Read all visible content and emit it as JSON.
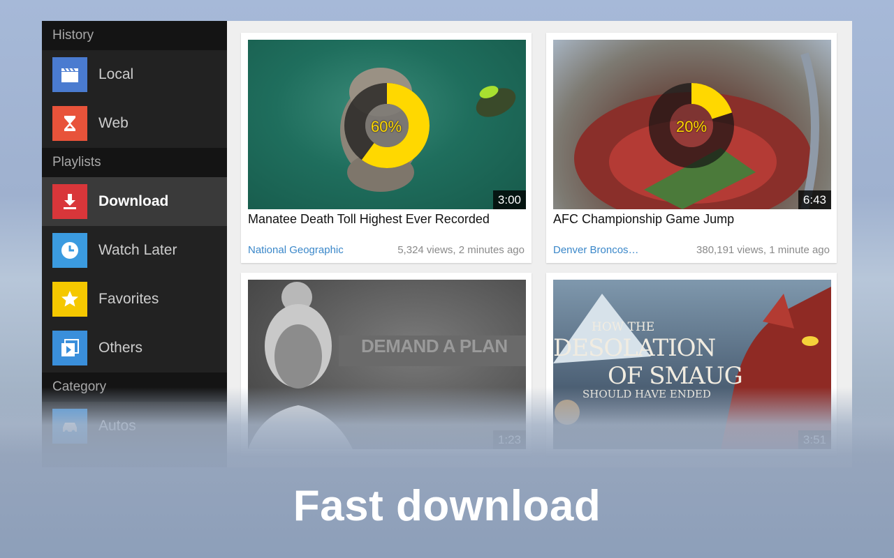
{
  "sidebar": {
    "history_header": "History",
    "history_items": [
      {
        "label": "Local",
        "icon": "clapperboard-icon",
        "color": "#4a7bd0"
      },
      {
        "label": "Web",
        "icon": "hourglass-icon",
        "color": "#e8533a"
      }
    ],
    "playlists_header": "Playlists",
    "playlist_items": [
      {
        "label": "Download",
        "icon": "download-icon",
        "color": "#d9363a",
        "active": true
      },
      {
        "label": "Watch Later",
        "icon": "clock-icon",
        "color": "#3b9be0"
      },
      {
        "label": "Favorites",
        "icon": "star-icon",
        "color": "#f5c800"
      },
      {
        "label": "Others",
        "icon": "video-stack-icon",
        "color": "#3a8fdb"
      }
    ],
    "category_header": "Category",
    "category_items": [
      {
        "label": "Autos",
        "icon": "car-icon",
        "color": "#3a8fdb"
      }
    ]
  },
  "videos": [
    {
      "title": "Manatee Death Toll Highest Ever Recorded",
      "channel": "National Geographic",
      "views": "5,324 views, 2 minutes ago",
      "duration": "3:00",
      "progress_label": "60%",
      "progress": 0.6
    },
    {
      "title": "AFC Championship Game Jump",
      "channel": "Denver Broncos…",
      "views": "380,191 views, 1 minute ago",
      "duration": "6:43",
      "progress_label": "20%",
      "progress": 0.2
    },
    {
      "title": "",
      "duration": "1:23",
      "thumb_text": "DEMAND A PLAN"
    },
    {
      "title": "",
      "duration": "3:51",
      "thumb_text_1": "How the",
      "thumb_text_2": "Desolation",
      "thumb_text_3": "of Smaug",
      "thumb_text_4": "Should have ended"
    }
  ],
  "caption": "Fast download",
  "colors": {
    "progress": "#ffd800",
    "link": "#3a87c9"
  }
}
